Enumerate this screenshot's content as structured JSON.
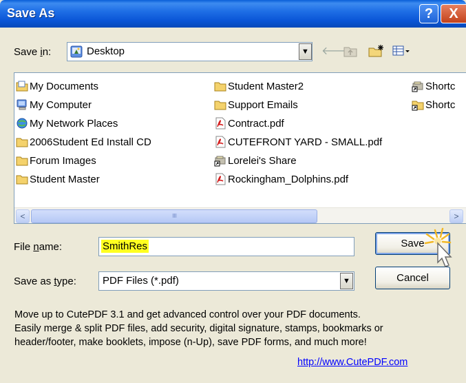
{
  "window": {
    "title": "Save As"
  },
  "titlebar": {
    "help_glyph": "?",
    "close_glyph": "X"
  },
  "save_in": {
    "label": "Save in:",
    "underline_char": "i",
    "value": "Desktop",
    "icon": "desktop-icon"
  },
  "toolbar": {
    "back_icon": "back-arrow-icon",
    "up_icon": "up-folder-icon",
    "new_folder_icon": "new-folder-icon",
    "views_icon": "views-menu-icon"
  },
  "files": [
    {
      "name": "My Documents",
      "icon": "my-documents-icon"
    },
    {
      "name": "My Computer",
      "icon": "computer-icon"
    },
    {
      "name": "My Network Places",
      "icon": "network-icon"
    },
    {
      "name": "2006Student Ed Install CD",
      "icon": "folder-icon"
    },
    {
      "name": "Forum Images",
      "icon": "folder-icon"
    },
    {
      "name": "Student Master",
      "icon": "folder-icon"
    },
    {
      "name": "Student Master2",
      "icon": "folder-icon"
    },
    {
      "name": "Support Emails",
      "icon": "folder-icon"
    },
    {
      "name": "Contract.pdf",
      "icon": "pdf-icon"
    },
    {
      "name": "CUTEFRONT YARD - SMALL.pdf",
      "icon": "pdf-icon"
    },
    {
      "name": "Lorelei's Share",
      "icon": "shortcut-icon"
    },
    {
      "name": "Rockingham_Dolphins.pdf",
      "icon": "pdf-icon"
    },
    {
      "name": "Shortc",
      "icon": "shortcut-icon"
    },
    {
      "name": "Shortc",
      "icon": "folder-shortcut-icon"
    }
  ],
  "scrollbar": {
    "left_arrow": "<",
    "right_arrow": ">",
    "grip": "IIIII"
  },
  "file_name": {
    "label": "File name:",
    "underline_char": "n",
    "value": "SmithRes"
  },
  "save_as_type": {
    "label": "Save as type:",
    "underline_char": "t",
    "value": "PDF Files (*.pdf)"
  },
  "buttons": {
    "save": "Save",
    "cancel": "Cancel"
  },
  "promo": {
    "line1": "Move up to CutePDF 3.1 and get advanced control over your PDF documents.",
    "line2": "Easily merge & split PDF files, add security, digital signature, stamps, bookmarks or",
    "line3": "header/footer, make booklets, impose (n-Up), save PDF forms, and much more!",
    "link": "http://www.CutePDF.com"
  },
  "colors": {
    "title_blue": "#0a55d6",
    "highlight_yellow": "#ffff20",
    "dialog_bg": "#ece9d8",
    "link_blue": "#0000ff"
  }
}
